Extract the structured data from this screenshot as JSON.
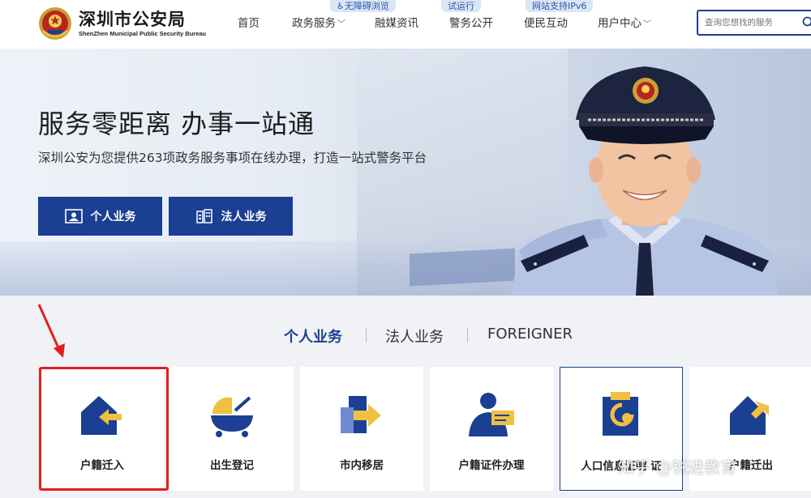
{
  "header": {
    "logo_cn": "深圳市公安局",
    "logo_en": "ShenZhen Municipal Public Security Bureau",
    "nav": [
      {
        "label": "首页"
      },
      {
        "label": "政务服务",
        "chev": "﹀"
      },
      {
        "label": "融媒资讯"
      },
      {
        "label": "警务公开"
      },
      {
        "label": "便民互动"
      },
      {
        "label": "用户中心",
        "chev": "﹀"
      }
    ],
    "tags": {
      "accessibility": "无障碍浏览",
      "trial": "试运行",
      "ipv6": "网站支持IPv6"
    },
    "search_placeholder": "查询您想找的服务"
  },
  "hero": {
    "title": "服务零距离 办事一站通",
    "subtitle": "深圳公安为您提供263项政务服务事项在线办理，打造一站式警务平台",
    "btn_personal": "个人业务",
    "btn_legal": "法人业务"
  },
  "tabs": [
    "个人业务",
    "法人业务",
    "FOREIGNER"
  ],
  "cards": [
    "户籍迁入",
    "出生登记",
    "市内移居",
    "户籍证件办理",
    "人口信息证明  证",
    "户籍迁出"
  ],
  "watermark": "知乎 @锐进教育",
  "colors": {
    "brand": "#1b3f92",
    "highlight": "#e02020",
    "accent": "#f0c040"
  }
}
